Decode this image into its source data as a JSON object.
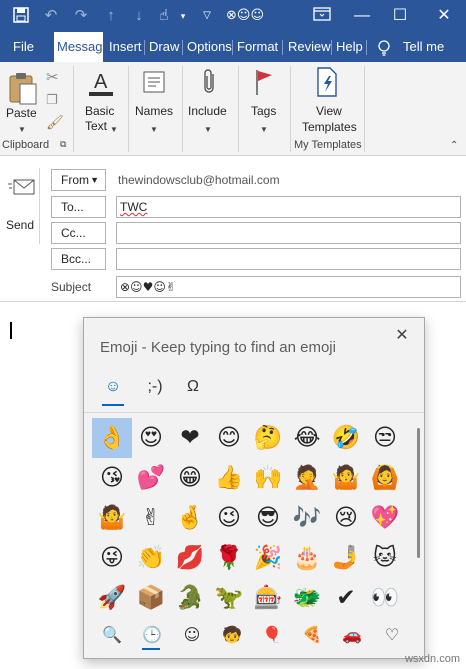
{
  "titlebar": {
    "title": "⊗☺☺",
    "icons": [
      "save-icon",
      "undo-icon",
      "redo-icon",
      "up-arrow-icon",
      "down-arrow-icon",
      "touch-mode-icon",
      "customize-icon"
    ],
    "win_controls": {
      "minimize": "—",
      "maximize": "☐",
      "close": "✕"
    }
  },
  "tabs": [
    "File",
    "Message",
    "Insert",
    "Draw",
    "Options",
    "Format",
    "Review",
    "Help",
    "Tell me"
  ],
  "ribbon": {
    "paste": "Paste",
    "clipboard": "Clipboard",
    "basic_text_1": "Basic",
    "basic_text_2": "Text",
    "names": "Names",
    "include": "Include",
    "tags": "Tags",
    "view_templates_1": "View",
    "view_templates_2": "Templates",
    "my_templates": "My Templates"
  },
  "compose": {
    "send": "Send",
    "from_label": "From",
    "from_value": "thewindowsclub@hotmail.com",
    "to_label": "To...",
    "to_value": "TWC",
    "cc_label": "Cc...",
    "bcc_label": "Bcc...",
    "subject_label": "Subject",
    "subject_value": "⊗☺♥☺✌"
  },
  "emoji_panel": {
    "title": "Emoji - Keep typing to find an emoji",
    "tabs": {
      "emoji": "☺",
      "kaomoji": ";-)",
      "symbols": "Ω"
    },
    "grid": [
      [
        "👌",
        "😍",
        "❤",
        "😊",
        "🤔",
        "😂",
        "🤣",
        "😒"
      ],
      [
        "😘",
        "💕",
        "😁",
        "👍",
        "🙌",
        "🤦",
        "🤷",
        "🙆"
      ],
      [
        "🤷",
        "✌",
        "🤞",
        "😉",
        "😎",
        "🎶",
        "😢",
        "💖"
      ],
      [
        "😜",
        "👏",
        "💋",
        "🌹",
        "🎉",
        "🎂",
        "🤳",
        "🐱"
      ],
      [
        "🚀",
        "📦",
        "🐊",
        "🦖",
        "🎰",
        "🐲",
        "✔",
        "👀"
      ]
    ],
    "extra_last_col": [
      "😒",
      "🙆",
      "💖",
      "🐱",
      "🙂"
    ],
    "categories": [
      "🔍",
      "🕒",
      "☺",
      "🧒",
      "🎈",
      "🍕",
      "🚗",
      "♡"
    ]
  },
  "watermark": "wsxdn.com",
  "colors": {
    "accent": "#2b579a",
    "panel_accent": "#0067c0"
  }
}
